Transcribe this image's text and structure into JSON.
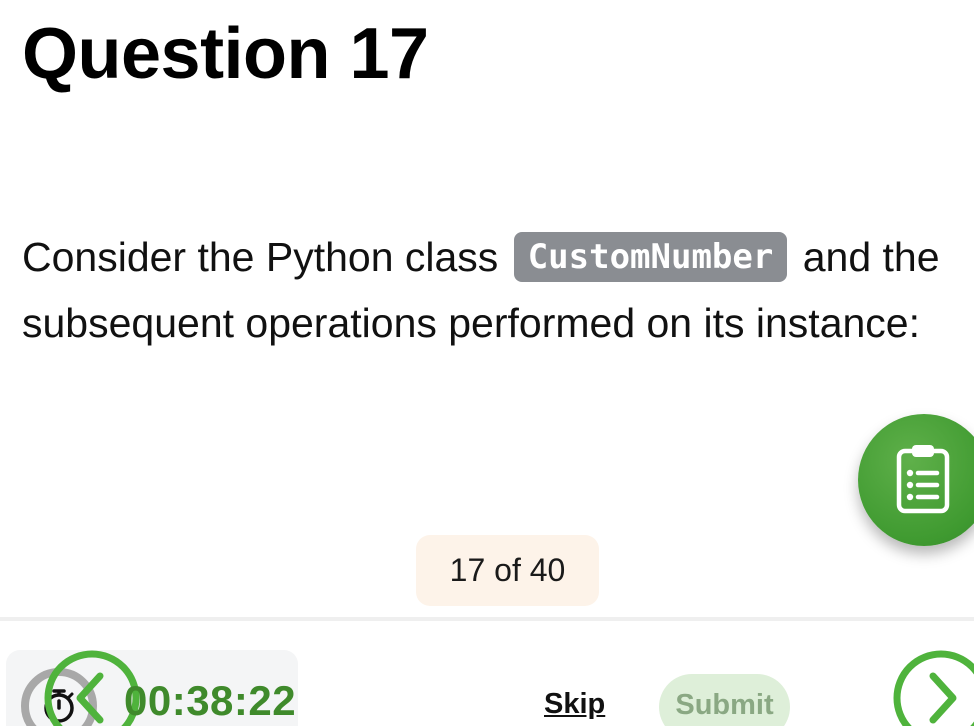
{
  "question": {
    "title": "Question 17",
    "text_before": "Consider the Python class ",
    "code": "CustomNumber",
    "text_after": " and the subsequent operations performed on its instance:"
  },
  "progress": {
    "label": "17 of 40",
    "current": 17,
    "total": 40
  },
  "footer": {
    "timer": "00:38:22",
    "skip_label": "Skip",
    "submit_label": "Submit"
  },
  "icons": {
    "fab": "clipboard-list-icon",
    "timer": "stopwatch-icon",
    "prev": "chevron-left-icon",
    "next": "chevron-right-icon"
  },
  "colors": {
    "accent": "#3f9a30",
    "timer_text": "#3f8a2b",
    "code_chip": "#8a8d92",
    "progress_pill": "#fdf3e9",
    "submit_disabled_bg": "#deefd9",
    "submit_disabled_text": "#8aa883"
  }
}
